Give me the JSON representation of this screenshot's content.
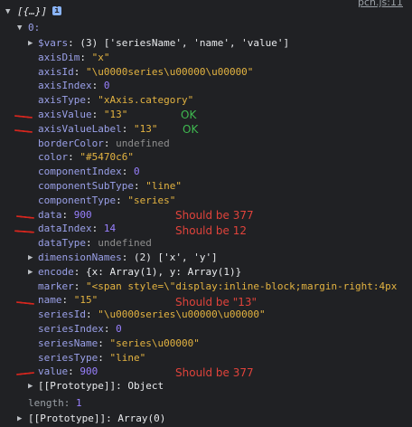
{
  "source_link": "pch.js:11",
  "header": "[{…}]",
  "item_index": "0:",
  "rows": [
    {
      "key": "$vars",
      "value": "(3) ['seriesName', 'name', 'value']",
      "vtype": "obj"
    },
    {
      "key": "axisDim",
      "value": "\"x\"",
      "vtype": "str"
    },
    {
      "key": "axisId",
      "value": "\"\\u0000series\\u00000\\u00000\"",
      "vtype": "str"
    },
    {
      "key": "axisIndex",
      "value": "0",
      "vtype": "num"
    },
    {
      "key": "axisType",
      "value": "\"xAxis.category\"",
      "vtype": "str"
    },
    {
      "key": "axisValue",
      "value": "\"13\"",
      "vtype": "str"
    },
    {
      "key": "axisValueLabel",
      "value": "\"13\"",
      "vtype": "str"
    },
    {
      "key": "borderColor",
      "value": "undefined",
      "vtype": "undef"
    },
    {
      "key": "color",
      "value": "\"#5470c6\"",
      "vtype": "str"
    },
    {
      "key": "componentIndex",
      "value": "0",
      "vtype": "num"
    },
    {
      "key": "componentSubType",
      "value": "\"line\"",
      "vtype": "str"
    },
    {
      "key": "componentType",
      "value": "\"series\"",
      "vtype": "str"
    },
    {
      "key": "data",
      "value": "900",
      "vtype": "num"
    },
    {
      "key": "dataIndex",
      "value": "14",
      "vtype": "num"
    },
    {
      "key": "dataType",
      "value": "undefined",
      "vtype": "undef"
    },
    {
      "key": "dimensionNames",
      "value": "(2) ['x', 'y']",
      "vtype": "obj"
    },
    {
      "key": "encode",
      "value": "{x: Array(1), y: Array(1)}",
      "vtype": "obj"
    },
    {
      "key": "marker",
      "value": "\"<span style=\\\"display:inline-block;margin-right:4px",
      "vtype": "str"
    },
    {
      "key": "name",
      "value": "\"15\"",
      "vtype": "str"
    },
    {
      "key": "seriesId",
      "value": "\"\\u0000series\\u00000\\u00000\"",
      "vtype": "str"
    },
    {
      "key": "seriesIndex",
      "value": "0",
      "vtype": "num"
    },
    {
      "key": "seriesName",
      "value": "\"series\\u00000\"",
      "vtype": "str"
    },
    {
      "key": "seriesType",
      "value": "\"line\"",
      "vtype": "str"
    },
    {
      "key": "value",
      "value": "900",
      "vtype": "num"
    },
    {
      "key": "[[Prototype]]",
      "value": "Object",
      "vtype": "obj"
    }
  ],
  "length_row": {
    "key": "length",
    "value": "1"
  },
  "proto_row": {
    "key": "[[Prototype]]",
    "value": "Array(0)"
  },
  "annotations": {
    "ok1": "OK",
    "ok2": "OK",
    "data_note": "Should be 377",
    "dataIndex_note": "Should be 12",
    "name_note": "Should be \"13\"",
    "value_note": "Should be 377"
  },
  "colors": {
    "ok": "#3fb950",
    "bad": "#e0433b",
    "underline": "#d7261e"
  }
}
